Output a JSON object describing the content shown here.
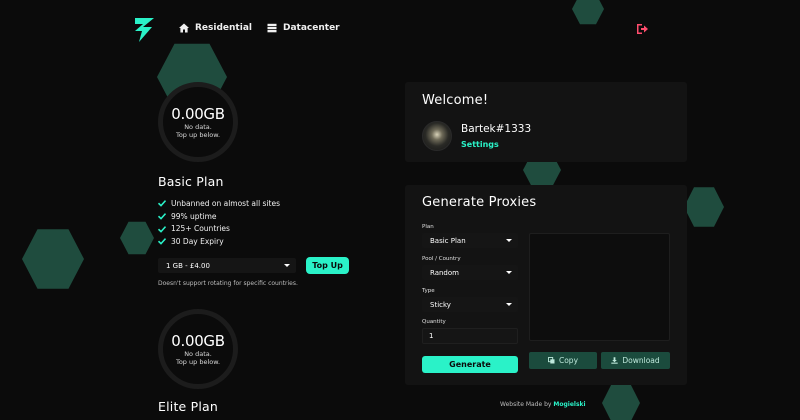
{
  "colors": {
    "accent": "#2af2c8",
    "hexagon": "#1f4c3e",
    "background": "#0b0b0b",
    "card": "#131313",
    "logout": "#ff4d6d"
  },
  "nav": {
    "items": [
      {
        "label": "Residential",
        "icon": "home-icon"
      },
      {
        "label": "Datacenter",
        "icon": "server-icon"
      }
    ],
    "logout_icon": "logout-icon"
  },
  "plans": [
    {
      "usage": "0.00GB",
      "usage_note_line1": "No data.",
      "usage_note_line2": "Top up below.",
      "name": "Basic Plan",
      "features": [
        "Unbanned on almost all sites",
        "99% uptime",
        "125+ Countries",
        "30 Day Expiry"
      ],
      "selected_option": "1 GB - £4.00",
      "topup_label": "Top Up",
      "note": "Doesn't support rotating for specific countries."
    },
    {
      "usage": "0.00GB",
      "usage_note_line1": "No data.",
      "usage_note_line2": "Top up below.",
      "name": "Elite Plan"
    }
  ],
  "welcome": {
    "title": "Welcome!",
    "username": "Bartek#1333",
    "settings_label": "Settings"
  },
  "generate": {
    "title": "Generate Proxies",
    "plan_label": "Plan",
    "plan_value": "Basic Plan",
    "pool_label": "Pool / Country",
    "pool_value": "Random",
    "type_label": "Type",
    "type_value": "Sticky",
    "quantity_label": "Quantity",
    "quantity_value": "1",
    "generate_label": "Generate",
    "copy_label": "Copy",
    "download_label": "Download"
  },
  "footer": {
    "prefix": "Website Made by",
    "author": "Mogielski"
  }
}
